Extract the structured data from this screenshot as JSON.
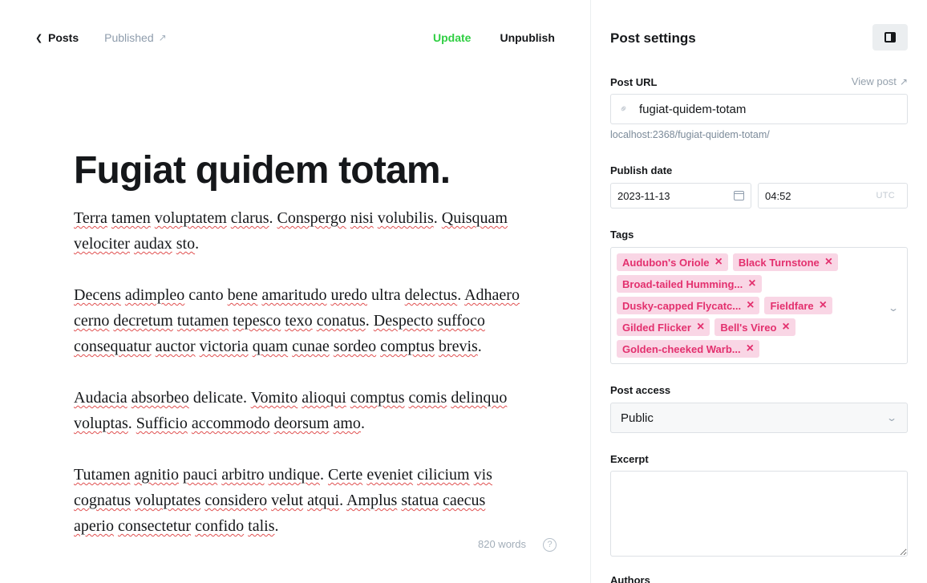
{
  "nav": {
    "back_label": "Posts",
    "status_label": "Published",
    "update_label": "Update",
    "unpublish_label": "Unpublish"
  },
  "post": {
    "title": "Fugiat quidem totam.",
    "paragraphs": [
      "Terra tamen voluptatem clarus. Conspergo nisi volubilis. Quisquam velociter audax sto.",
      "Decens adimpleo canto bene amaritudo uredo ultra delectus. Adhaero cerno decretum tutamen tepesco texo conatus. Despecto suffoco consequatur auctor victoria quam cunae sordeo comptus brevis.",
      "Audacia absorbeo delicate. Vomito alioqui comptus comis delinquo voluptas. Sufficio accommodo deorsum amo.",
      "Tutamen agnitio pauci arbitro undique. Certe eveniet cilicium vis cognatus voluptates considero velut atqui. Amplus statua caecus aperio consectetur confido talis."
    ],
    "word_count": "820 words",
    "help_glyph": "?"
  },
  "settings": {
    "title": "Post settings",
    "url": {
      "label": "Post URL",
      "view_label": "View post",
      "value": "fugiat-quidem-totam",
      "hint": "localhost:2368/fugiat-quidem-totam/"
    },
    "publish_date": {
      "label": "Publish date",
      "date": "2023-11-13",
      "time": "04:52",
      "timezone": "UTC"
    },
    "tags": {
      "label": "Tags",
      "items": [
        "Audubon's Oriole",
        "Black Turnstone",
        "Broad-tailed Humming...",
        "Dusky-capped Flycatc...",
        "Fieldfare",
        "Gilded Flicker",
        "Bell's Vireo",
        "Golden-cheeked Warb..."
      ]
    },
    "access": {
      "label": "Post access",
      "value": "Public"
    },
    "excerpt": {
      "label": "Excerpt",
      "value": ""
    },
    "authors": {
      "label": "Authors"
    }
  },
  "colors": {
    "accent_green": "#30cf43",
    "tag_bg": "#f9d6e5",
    "tag_text": "#e3306e"
  }
}
